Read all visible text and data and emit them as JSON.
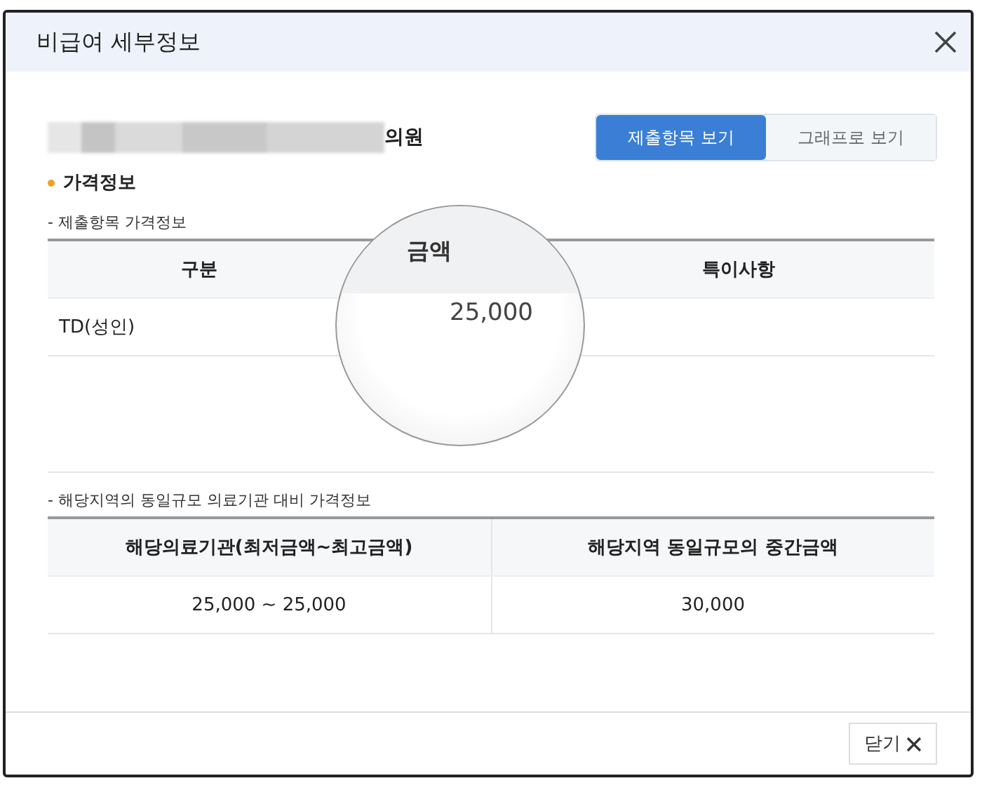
{
  "dialog": {
    "title": "비급여 세부정보"
  },
  "clinic": {
    "name_suffix": "의원"
  },
  "view_tabs": [
    {
      "label": "제출항목 보기",
      "selected": true
    },
    {
      "label": "그래프로 보기",
      "selected": false
    }
  ],
  "section_title": "가격정보",
  "submitted": {
    "caption": "- 제출항목 가격정보",
    "columns": [
      "구분",
      "금액",
      "특이사항"
    ],
    "rows": [
      {
        "category": "TD(성인)",
        "amount": "25,000"
      }
    ]
  },
  "comparison": {
    "caption": "- 해당지역의 동일규모 의료기관 대비 가격정보",
    "columns": [
      "해당의료기관(최저금액~최고금액)",
      "해당지역 동일규모의 중간금액"
    ],
    "rows": [
      [
        "25,000 ~ 25,000",
        "30,000"
      ]
    ]
  },
  "footer": {
    "close_label": "닫기"
  }
}
